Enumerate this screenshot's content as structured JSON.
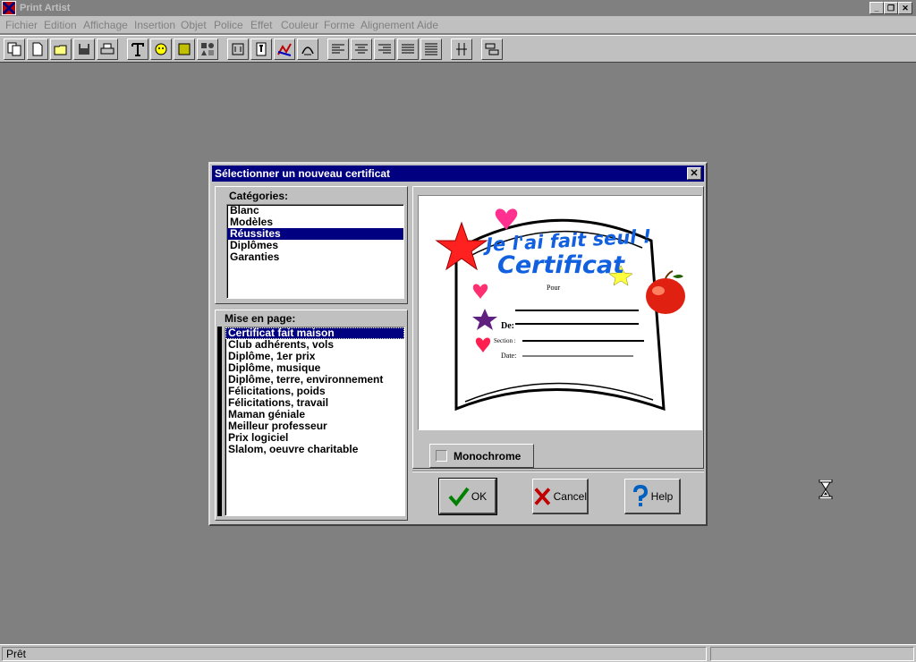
{
  "app": {
    "title": "Print Artist"
  },
  "menu": [
    "Fichier",
    "Edition",
    "Affichage",
    "Insertion",
    "Objet",
    "Police",
    "Effet",
    "Couleur",
    "Forme",
    "Alignement",
    "Aide"
  ],
  "toolbar_icons": [
    "copy-icon",
    "new-document-icon",
    "open-folder-icon",
    "save-icon",
    "print-icon",
    "text-tool-icon",
    "graphic-tool-icon",
    "square-tool-icon",
    "shapes-tool-icon",
    "headline-icon",
    "text-style-icon",
    "draw-icon",
    "curve-text-icon",
    "align-left-icon",
    "align-center-icon",
    "align-right-icon",
    "justify-icon",
    "justify-spread-icon",
    "vertical-align-icon",
    "layers-icon"
  ],
  "dialog": {
    "title": "Sélectionner un nouveau certificat",
    "categories_label": "Catégories:",
    "categories": [
      "Blanc",
      "Modèles",
      "Réussites",
      "Diplômes",
      "Garanties"
    ],
    "selected_category": "Réussites",
    "layout_label": "Mise en page:",
    "layouts": [
      "Certificat fait maison",
      "Club adhérents, vols",
      "Diplôme, 1er prix",
      "Diplôme, musique",
      "Diplôme, terre, environnement",
      "Félicitations, poids",
      "Félicitations, travail",
      "Maman géniale",
      "Meilleur professeur",
      "Prix logiciel",
      "Slalom, oeuvre charitable"
    ],
    "selected_layout": "Certificat fait maison",
    "preview": {
      "heading": "Je l'ai fait seul !",
      "title": "Certificat",
      "pour": "Pour",
      "de": "De:",
      "section": "Section :",
      "date": "Date:"
    },
    "monochrome_label": "Monochrome",
    "ok_label": "OK",
    "cancel_label": "Cancel",
    "help_label": "Help"
  },
  "status": {
    "text": "Prêt"
  }
}
